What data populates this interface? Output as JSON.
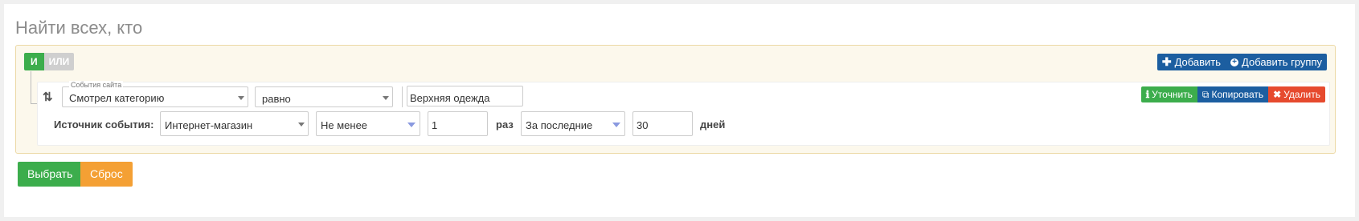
{
  "page": {
    "title": "Найти всех, кто"
  },
  "group": {
    "logic_and": "И",
    "logic_or": "ИЛИ",
    "add_label": "Добавить",
    "add_group_label": "Добавить группу"
  },
  "rule": {
    "field_legend": "События сайта",
    "field_value": "Смотрел категорию",
    "operator_value": "равно",
    "param_value": "Верхняя одежда",
    "refine_label": "Уточнить",
    "copy_label": "Копировать",
    "delete_label": "Удалить",
    "source_label": "Источник события:",
    "source_value": "Интернет-магазин",
    "count_op_value": "Не менее",
    "count_value": "1",
    "times_label": "раз",
    "period_op_value": "За последние",
    "period_value": "30",
    "days_label": "дней"
  },
  "footer": {
    "select_label": "Выбрать",
    "reset_label": "Сброс"
  },
  "colors": {
    "green": "#3cad4c",
    "blue": "#1c5ea0",
    "red": "#e64a2e",
    "orange": "#f4a034",
    "group_bg": "#fcf8ec"
  }
}
